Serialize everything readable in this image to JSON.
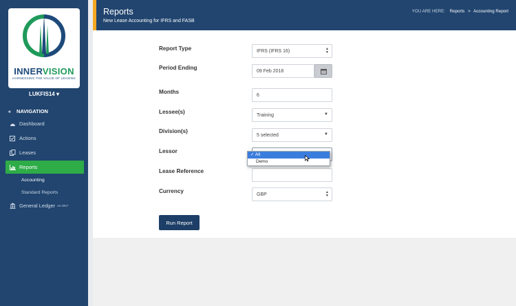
{
  "brand": {
    "name_part1": "INNER",
    "name_part2": "VISION",
    "tagline": "HARNESSING THE VALUE OF LEASING"
  },
  "user": {
    "name": "LUKFIS14",
    "caret": "▾"
  },
  "nav": {
    "heading": "NAVIGATION",
    "items": [
      {
        "label": "Dashboard",
        "icon": "dashboard-icon"
      },
      {
        "label": "Actions",
        "icon": "check-square-icon"
      },
      {
        "label": "Leases",
        "icon": "documents-icon"
      },
      {
        "label": "Reports",
        "icon": "bar-chart-icon",
        "active": true
      },
      {
        "label": "General Ledger",
        "icon": "bank-icon",
        "note": "v6.3957"
      }
    ],
    "subitems": [
      {
        "label": "Accounting",
        "active": true
      },
      {
        "label": "Standard Reports"
      }
    ]
  },
  "header": {
    "title": "Reports",
    "subtitle": "New Lease Accounting for IFRS and FASB",
    "breadcrumb": {
      "label": "YOU ARE HERE:",
      "items": [
        "Reports",
        "Accounting Report"
      ],
      "separator": ">"
    }
  },
  "form": {
    "report_type": {
      "label": "Report Type",
      "value": "IFRS (IFRS 16)"
    },
    "period_ending": {
      "label": "Period Ending",
      "value": "09 Feb 2018"
    },
    "months": {
      "label": "Months",
      "value": "6"
    },
    "lessees": {
      "label": "Lessee(s)",
      "value": "Training"
    },
    "divisions": {
      "label": "Division(s)",
      "value": "5 selected"
    },
    "lessor": {
      "label": "Lessor",
      "options": [
        "All",
        "Demo"
      ],
      "selected": "All",
      "check": "✓"
    },
    "lease_reference": {
      "label": "Lease Reference",
      "value": ""
    },
    "currency": {
      "label": "Currency",
      "value": "GBP"
    }
  },
  "actions": {
    "run_report": "Run Report"
  },
  "colors": {
    "sidebar": "#21456f",
    "accent": "#f7a823",
    "active_nav": "#2eac48",
    "button": "#1d3e66",
    "dropdown_selected": "#3b7ddd"
  }
}
